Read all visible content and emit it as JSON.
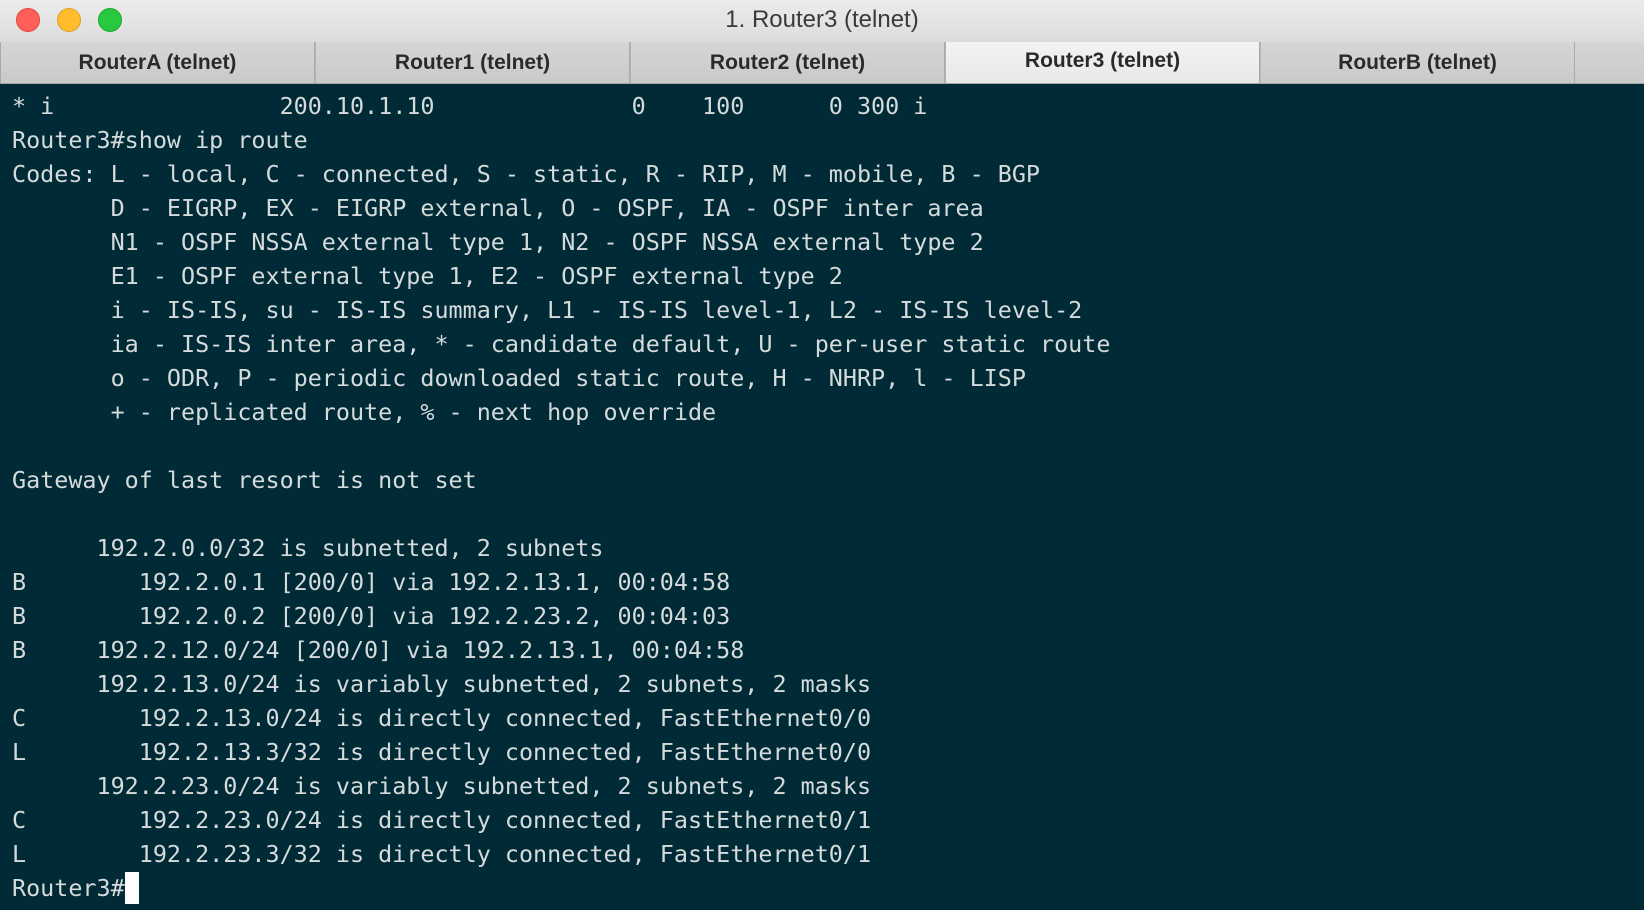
{
  "window": {
    "title": "1. Router3 (telnet)"
  },
  "tabs": [
    {
      "label": "RouterA (telnet)",
      "active": false
    },
    {
      "label": "Router1 (telnet)",
      "active": false
    },
    {
      "label": "Router2 (telnet)",
      "active": false
    },
    {
      "label": "Router3 (telnet)",
      "active": true
    },
    {
      "label": "RouterB (telnet)",
      "active": false
    }
  ],
  "terminal": {
    "lines": [
      "* i                200.10.1.10              0    100      0 300 i",
      "Router3#show ip route",
      "Codes: L - local, C - connected, S - static, R - RIP, M - mobile, B - BGP",
      "       D - EIGRP, EX - EIGRP external, O - OSPF, IA - OSPF inter area",
      "       N1 - OSPF NSSA external type 1, N2 - OSPF NSSA external type 2",
      "       E1 - OSPF external type 1, E2 - OSPF external type 2",
      "       i - IS-IS, su - IS-IS summary, L1 - IS-IS level-1, L2 - IS-IS level-2",
      "       ia - IS-IS inter area, * - candidate default, U - per-user static route",
      "       o - ODR, P - periodic downloaded static route, H - NHRP, l - LISP",
      "       + - replicated route, % - next hop override",
      "",
      "Gateway of last resort is not set",
      "",
      "      192.2.0.0/32 is subnetted, 2 subnets",
      "B        192.2.0.1 [200/0] via 192.2.13.1, 00:04:58",
      "B        192.2.0.2 [200/0] via 192.2.23.2, 00:04:03",
      "B     192.2.12.0/24 [200/0] via 192.2.13.1, 00:04:58",
      "      192.2.13.0/24 is variably subnetted, 2 subnets, 2 masks",
      "C        192.2.13.0/24 is directly connected, FastEthernet0/0",
      "L        192.2.13.3/32 is directly connected, FastEthernet0/0",
      "      192.2.23.0/24 is variably subnetted, 2 subnets, 2 masks",
      "C        192.2.23.0/24 is directly connected, FastEthernet0/1",
      "L        192.2.23.3/32 is directly connected, FastEthernet0/1"
    ],
    "prompt": "Router3#"
  },
  "colors": {
    "terminal_background": "#002b36",
    "terminal_text": "#d5dadb",
    "cursor": "#ffffff"
  }
}
